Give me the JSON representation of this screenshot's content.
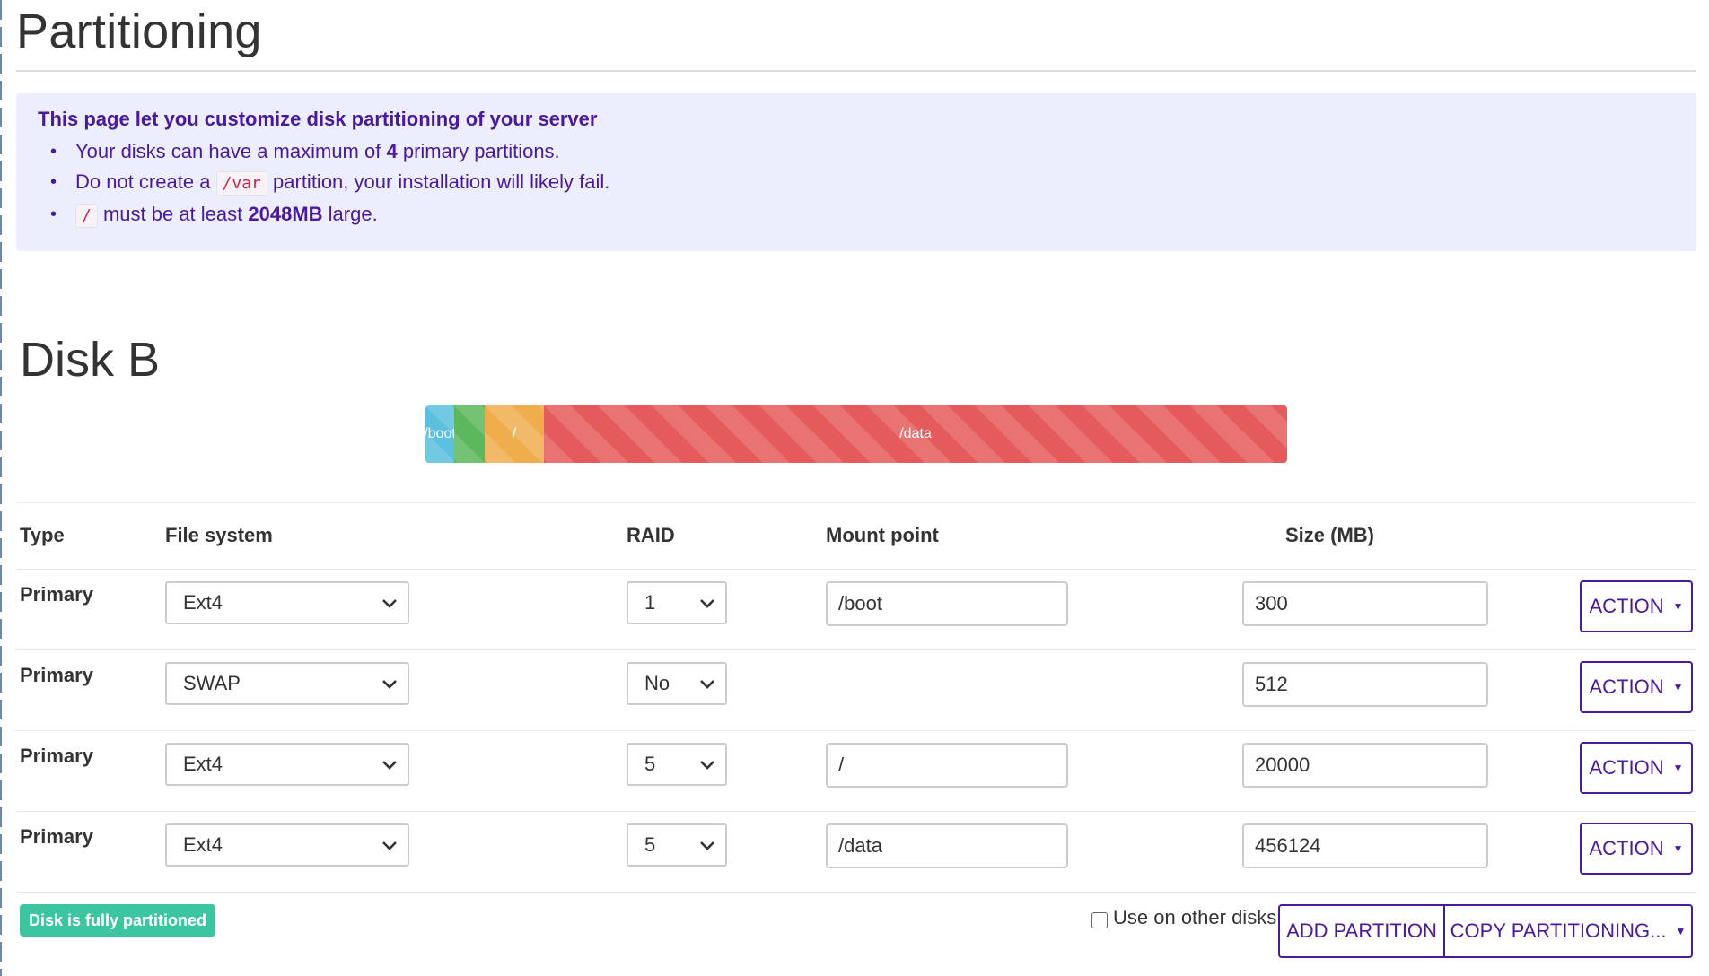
{
  "page": {
    "title": "Partitioning"
  },
  "info": {
    "title": "This page let you customize disk partitioning of your server",
    "line1_pre": "Your disks can have a maximum of ",
    "line1_bold": "4",
    "line1_post": " primary partitions.",
    "line2_pre": "Do not create a ",
    "line2_code": "/var",
    "line2_post": " partition, your installation will likely fail.",
    "line3_code": "/",
    "line3_mid": " must be at least ",
    "line3_bold": "2048MB",
    "line3_post": " large."
  },
  "disk": {
    "title": "Disk B",
    "bar": [
      {
        "label": "/boot",
        "color": "#5bc0de"
      },
      {
        "label": "",
        "color": "#5cb85c"
      },
      {
        "label": "/",
        "color": "#f0ad4e"
      },
      {
        "label": "/data",
        "color": "#e55a5a"
      }
    ]
  },
  "table": {
    "headers": {
      "type": "Type",
      "filesystem": "File system",
      "raid": "RAID",
      "mount": "Mount point",
      "size": "Size (MB)"
    },
    "rows": [
      {
        "type": "Primary",
        "fs": "Ext4",
        "raid": "1",
        "mount": "/boot",
        "size": "300",
        "action": "ACTION"
      },
      {
        "type": "Primary",
        "fs": "SWAP",
        "raid": "No",
        "mount": "",
        "size": "512",
        "action": "ACTION"
      },
      {
        "type": "Primary",
        "fs": "Ext4",
        "raid": "5",
        "mount": "/",
        "size": "20000",
        "action": "ACTION"
      },
      {
        "type": "Primary",
        "fs": "Ext4",
        "raid": "5",
        "mount": "/data",
        "size": "456124",
        "action": "ACTION"
      }
    ]
  },
  "footer": {
    "badge": "Disk is fully partitioned",
    "use_other_disks": "Use on other disks",
    "add_partition": "ADD PARTITION",
    "copy_partitioning": "COPY PARTITIONING..."
  }
}
